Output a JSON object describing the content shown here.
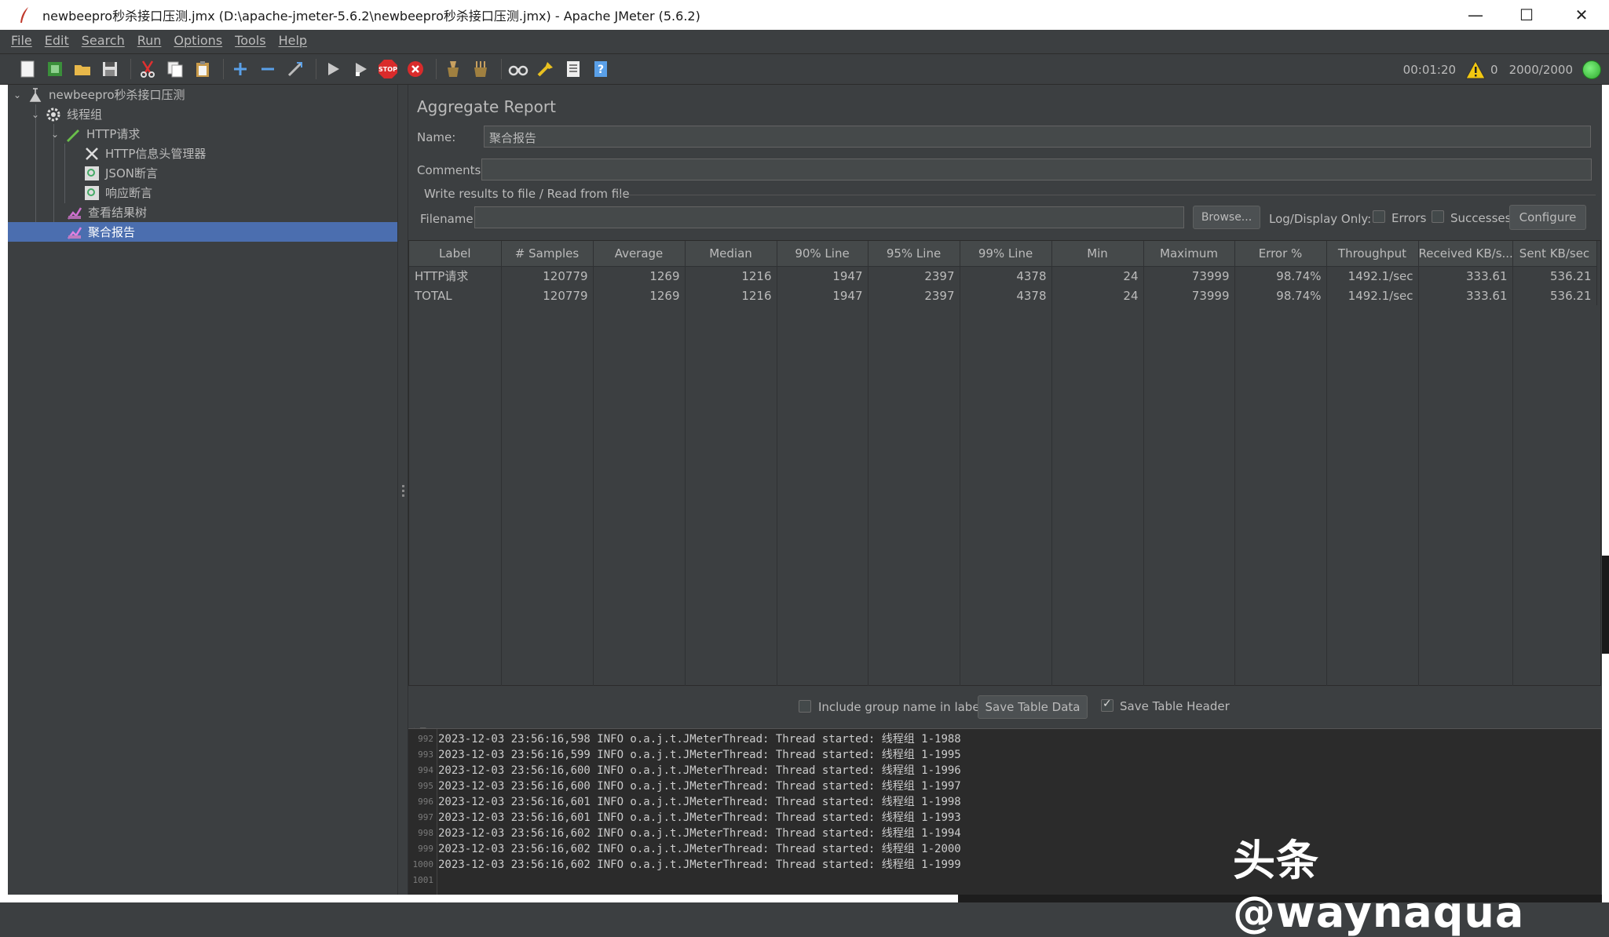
{
  "window": {
    "title": "newbeepro秒杀接口压测.jmx (D:\\apache-jmeter-5.6.2\\newbeepro秒杀接口压测.jmx) - Apache JMeter (5.6.2)",
    "minimize": "—",
    "maximize": "☐",
    "close": "✕"
  },
  "menu": [
    "File",
    "Edit",
    "Search",
    "Run",
    "Options",
    "Tools",
    "Help"
  ],
  "status": {
    "elapsed": "00:01:20",
    "warnings": "0",
    "threads": "2000/2000"
  },
  "tree": [
    {
      "label": "newbeepro秒杀接口压测",
      "icon": "test-plan-icon"
    },
    {
      "label": "线程组",
      "icon": "thread-group-gear-icon"
    },
    {
      "label": "HTTP请求",
      "icon": "http-request-pen-icon"
    },
    {
      "label": "HTTP信息头管理器",
      "icon": "header-manager-tools-icon"
    },
    {
      "label": "JSON断言",
      "icon": "assertion-magnifier-icon"
    },
    {
      "label": "响应断言",
      "icon": "assertion-magnifier-icon"
    },
    {
      "label": "查看结果树",
      "icon": "listener-chart-icon"
    },
    {
      "label": "聚合报告",
      "icon": "listener-chart-icon"
    }
  ],
  "report": {
    "title": "Aggregate Report",
    "name_label": "Name:",
    "name_value": "聚合报告",
    "comments_label": "Comments:",
    "comments_value": "",
    "file_group_title": "Write results to file / Read from file",
    "filename_label": "Filename",
    "filename_value": "",
    "browse_label": "Browse...",
    "log_display_label": "Log/Display Only:",
    "errors_label": "Errors",
    "successes_label": "Successes",
    "configure_label": "Configure",
    "include_group_label": "Include group name in label?",
    "save_table_data_label": "Save Table Data",
    "save_table_header_label": "Save Table Header"
  },
  "table": {
    "columns": [
      "Label",
      "# Samples",
      "Average",
      "Median",
      "90% Line",
      "95% Line",
      "99% Line",
      "Min",
      "Maximum",
      "Error %",
      "Throughput",
      "Received KB/s...",
      "Sent KB/sec"
    ],
    "rows": [
      [
        "HTTP请求",
        "120779",
        "1269",
        "1216",
        "1947",
        "2397",
        "4378",
        "24",
        "73999",
        "98.74%",
        "1492.1/sec",
        "333.61",
        "536.21"
      ],
      [
        "TOTAL",
        "120779",
        "1269",
        "1216",
        "1947",
        "2397",
        "4378",
        "24",
        "73999",
        "98.74%",
        "1492.1/sec",
        "333.61",
        "536.21"
      ]
    ]
  },
  "log": {
    "lines": [
      {
        "num": "992",
        "text": "2023-12-03 23:56:16,598 INFO o.a.j.t.JMeterThread: Thread started: 线程组 1-1988"
      },
      {
        "num": "993",
        "text": "2023-12-03 23:56:16,599 INFO o.a.j.t.JMeterThread: Thread started: 线程组 1-1995"
      },
      {
        "num": "994",
        "text": "2023-12-03 23:56:16,600 INFO o.a.j.t.JMeterThread: Thread started: 线程组 1-1996"
      },
      {
        "num": "995",
        "text": "2023-12-03 23:56:16,600 INFO o.a.j.t.JMeterThread: Thread started: 线程组 1-1997"
      },
      {
        "num": "996",
        "text": "2023-12-03 23:56:16,601 INFO o.a.j.t.JMeterThread: Thread started: 线程组 1-1998"
      },
      {
        "num": "997",
        "text": "2023-12-03 23:56:16,601 INFO o.a.j.t.JMeterThread: Thread started: 线程组 1-1993"
      },
      {
        "num": "998",
        "text": "2023-12-03 23:56:16,602 INFO o.a.j.t.JMeterThread: Thread started: 线程组 1-1994"
      },
      {
        "num": "999",
        "text": "2023-12-03 23:56:16,602 INFO o.a.j.t.JMeterThread: Thread started: 线程组 1-2000"
      },
      {
        "num": "1000",
        "text": "2023-12-03 23:56:16,602 INFO o.a.j.t.JMeterThread: Thread started: 线程组 1-1999"
      },
      {
        "num": "1001",
        "text": ""
      }
    ]
  },
  "watermark": "头条 @waynaqua",
  "toolbar_icons": [
    "new-icon",
    "templates-icon",
    "open-icon",
    "save-icon",
    "cut-icon",
    "copy-icon",
    "paste-icon",
    "expand-icon",
    "collapse-icon",
    "toggle-icon",
    "start-icon",
    "start-no-pauses-icon",
    "stop-icon",
    "shutdown-icon",
    "clear-icon",
    "clear-all-icon",
    "search-icon",
    "reset-search-icon",
    "function-helper-icon",
    "help-icon"
  ],
  "colors": {
    "selected": "#4b6eaf",
    "background": "#3c3f41",
    "log_background": "#2b2b2b"
  }
}
